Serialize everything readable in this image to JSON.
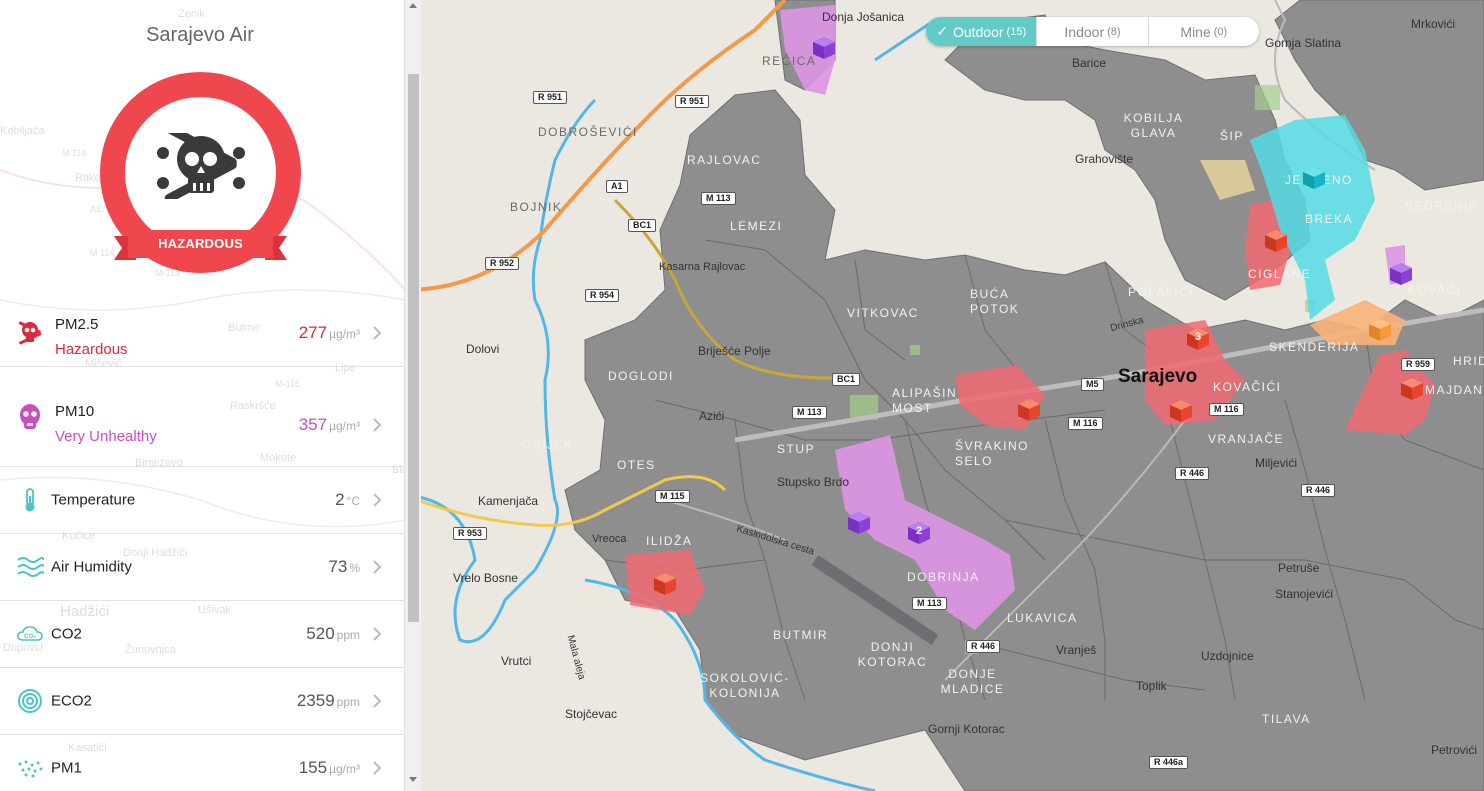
{
  "sidebar": {
    "title": "Sarajevo Air",
    "status_label": "HAZARDOUS",
    "status_color": "#f0474f",
    "metrics": [
      {
        "name": "PM2.5",
        "status": "Hazardous",
        "value": "277",
        "unit": "µg/m³",
        "icon": "skull-crossbones-icon",
        "status_color": "#e0283a"
      },
      {
        "name": "PM10",
        "status": "Very Unhealthy",
        "value": "357",
        "unit": "µg/m³",
        "icon": "gas-mask-icon",
        "status_color": "#c94fc0"
      },
      {
        "name": "Temperature",
        "value": "2",
        "unit": "°C",
        "icon": "thermometer-icon"
      },
      {
        "name": "Air Humidity",
        "value": "73",
        "unit": "%",
        "icon": "humidity-waves-icon"
      },
      {
        "name": "CO2",
        "value": "520",
        "unit": "ppm",
        "icon": "co2-cloud-icon"
      },
      {
        "name": "ECO2",
        "value": "2359",
        "unit": "ppm",
        "icon": "eco2-signal-icon"
      },
      {
        "name": "PM1",
        "value": "155",
        "unit": "µg/m³",
        "icon": "pm1-dots-icon"
      }
    ],
    "background_labels": [
      "Zenik",
      "Kobiljača",
      "Rakov",
      "M 114",
      "A1",
      "M 114",
      "M-114",
      "Butmir",
      "Mišević",
      "M-116",
      "Lipe",
      "Raskršće",
      "Binježevo",
      "Mokote",
      "Donji Hadžići",
      "Kučice",
      "Hadžići",
      "Ušivak",
      "Dupovci",
      "Žunovnica",
      "Kasatići",
      "Blažuj"
    ]
  },
  "toggle": {
    "tabs": [
      {
        "label": "Outdoor",
        "count": "(15)",
        "active": true
      },
      {
        "label": "Indoor",
        "count": "(8)",
        "active": false
      },
      {
        "label": "Mine",
        "count": "(0)",
        "active": false
      }
    ],
    "active_color": "#63cbc5"
  },
  "map": {
    "city_label": "Sarajevo",
    "district_labels": [
      "REČICA",
      "DOBROŠEVIĆI",
      "BOJNIK",
      "RAJLOVAC",
      "LEMEZI",
      "DOGLODI",
      "OTES",
      "OSIJEK",
      "ILIDŽA",
      "STUP",
      "VITKOVAC",
      "ALIPAŠIN MOST",
      "ŠVRAKINO SELO",
      "BUĆA POTOK",
      "POFALIĆI",
      "KOVAČIĆI",
      "VRANJAČE",
      "SKENDERIJA",
      "CIGLANE",
      "BREKA",
      "SEDRENIK",
      "KOVAČI",
      "HRID",
      "MAJDAN",
      "DOBRINJA",
      "BUTMIR",
      "DONJI KOTORAC",
      "SOKOLOVIĆ-KOLONIJA",
      "DONJE MLADICE",
      "LUKAVICA",
      "TILAVA",
      "KOBILJA GLAVA",
      "ŠIP",
      "JEDRENO"
    ],
    "place_labels": [
      "Donja Jošanica",
      "Gornja Slatina",
      "Mrkovići",
      "Barice",
      "Grahovište",
      "Kasarna Rajlovac",
      "Briješće Polje",
      "Dolovi",
      "Azići",
      "Stupsko Brdo",
      "Kamenjača",
      "Vrelo Bosne",
      "Vrutci",
      "Stojčevac",
      "Miljevići",
      "Petruše",
      "Stanojevići",
      "Vranješ",
      "Uzdojnice",
      "Toplik",
      "Gornji Kotorac",
      "Petrovići",
      "Vreoca",
      "Kasindolska cesta",
      "Drinska",
      "Mala aleja"
    ],
    "road_labels": [
      "R 951",
      "R 951",
      "A1",
      "M 113",
      "BC1",
      "R 952",
      "R 954",
      "BC1",
      "M 113",
      "M5",
      "M 116",
      "M 116",
      "M 115",
      "R 953",
      "M 113",
      "R 446",
      "R 446",
      "R 446",
      "R 959",
      "R 446a"
    ],
    "cluster_counts": [
      "3",
      "2"
    ],
    "colors": {
      "hazardous": "#f26a72",
      "very_unhealthy": "#d98fe0",
      "unhealthy_sensor": "#e8452f",
      "purple_sensor": "#8e3fd6",
      "teal_zone": "#52dce0",
      "orange_zone": "#f9b37a",
      "gray_zone": "#8c8c8c"
    }
  }
}
